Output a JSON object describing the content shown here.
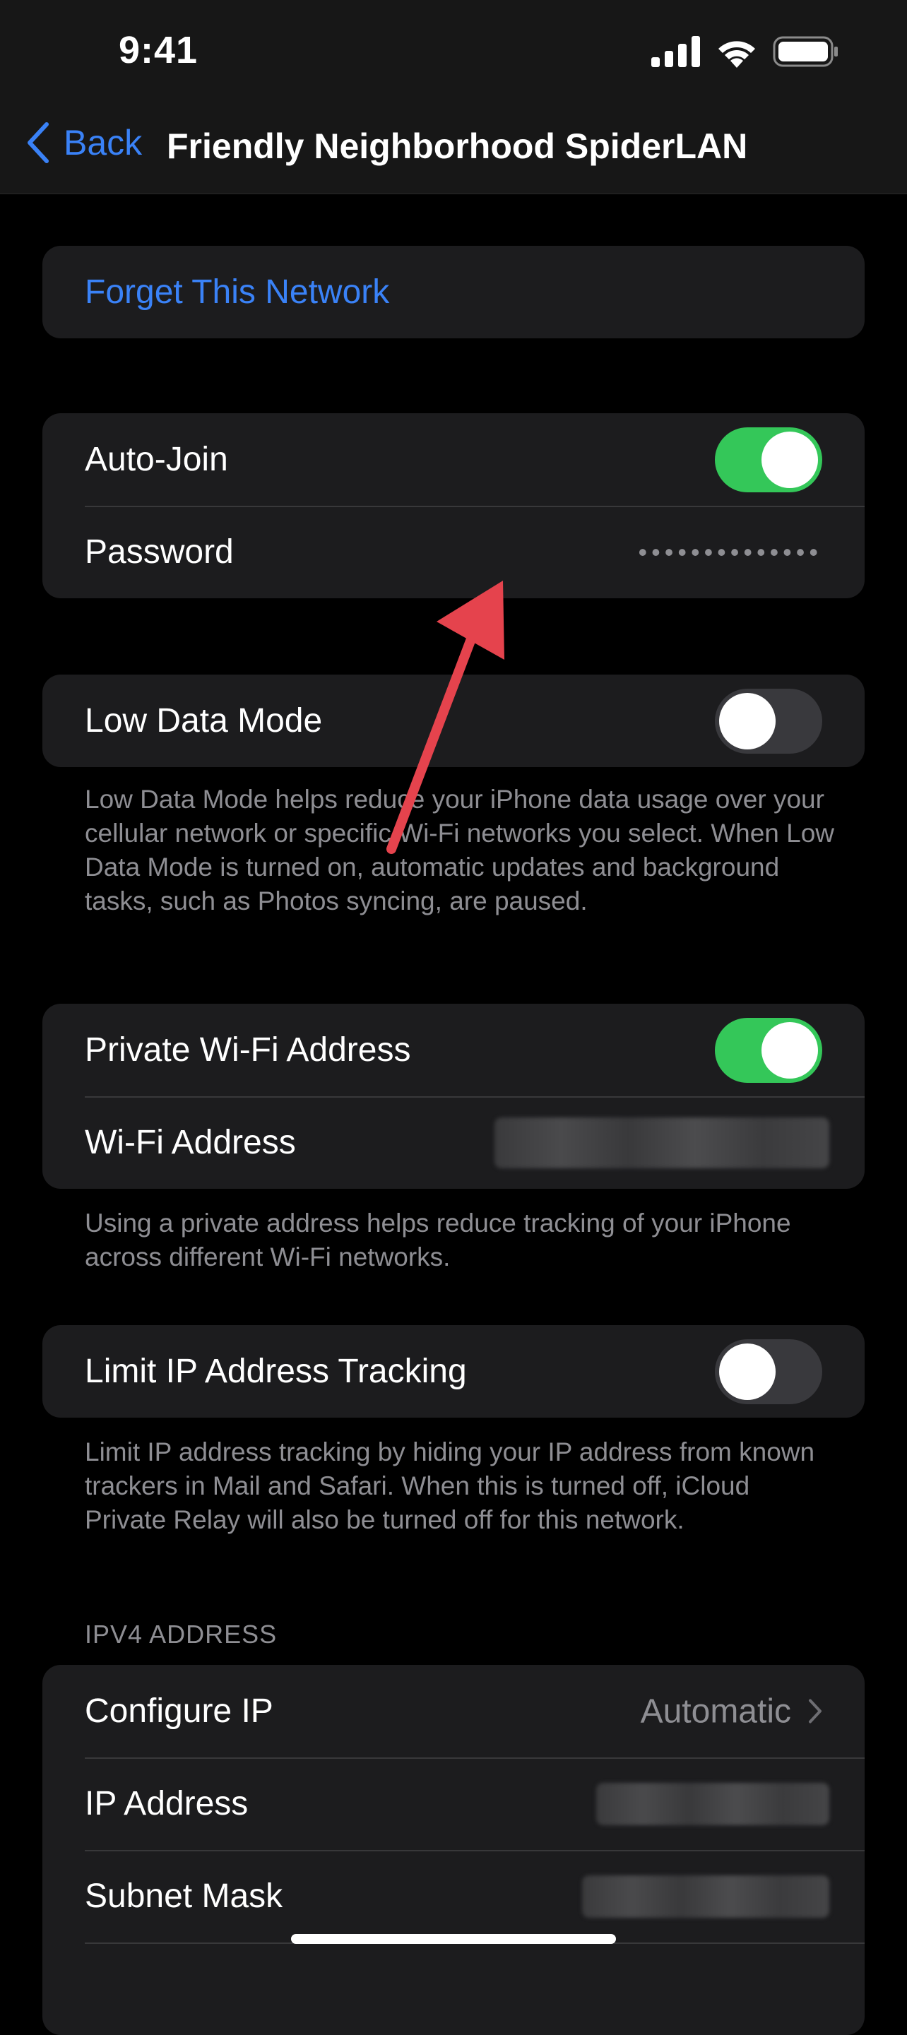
{
  "status_bar": {
    "time": "9:41",
    "icons": [
      "cellular-signal-icon",
      "wifi-icon",
      "battery-icon"
    ]
  },
  "nav": {
    "back_label": "Back",
    "title": "Friendly Neighborhood SpiderLAN"
  },
  "forget_network": {
    "label": "Forget This Network"
  },
  "join_group": {
    "auto_join_label": "Auto-Join",
    "auto_join_on": true,
    "password_label": "Password",
    "password_value": "••••••••••••••"
  },
  "low_data": {
    "label": "Low Data Mode",
    "on": false,
    "footnote": "Low Data Mode helps reduce your iPhone data usage over your cellular network or specific Wi-Fi networks you select. When Low Data Mode is turned on, automatic updates and background tasks, such as Photos syncing, are paused."
  },
  "private_address": {
    "label": "Private Wi-Fi Address",
    "on": true,
    "wifi_address_label": "Wi-Fi Address",
    "footnote": "Using a private address helps reduce tracking of your iPhone across different Wi-Fi networks."
  },
  "limit_ip": {
    "label": "Limit IP Address Tracking",
    "on": false,
    "footnote": "Limit IP address tracking by hiding your IP address from known trackers in Mail and Safari. When this is turned off, iCloud Private Relay will also be turned off for this network."
  },
  "ipv4": {
    "header": "IPV4 ADDRESS",
    "configure_ip_label": "Configure IP",
    "configure_ip_value": "Automatic",
    "ip_address_label": "IP Address",
    "subnet_mask_label": "Subnet Mask"
  },
  "colors": {
    "accent": "#3a82f7",
    "toggle_on": "#34c759",
    "annotation_arrow": "#e5434d"
  }
}
